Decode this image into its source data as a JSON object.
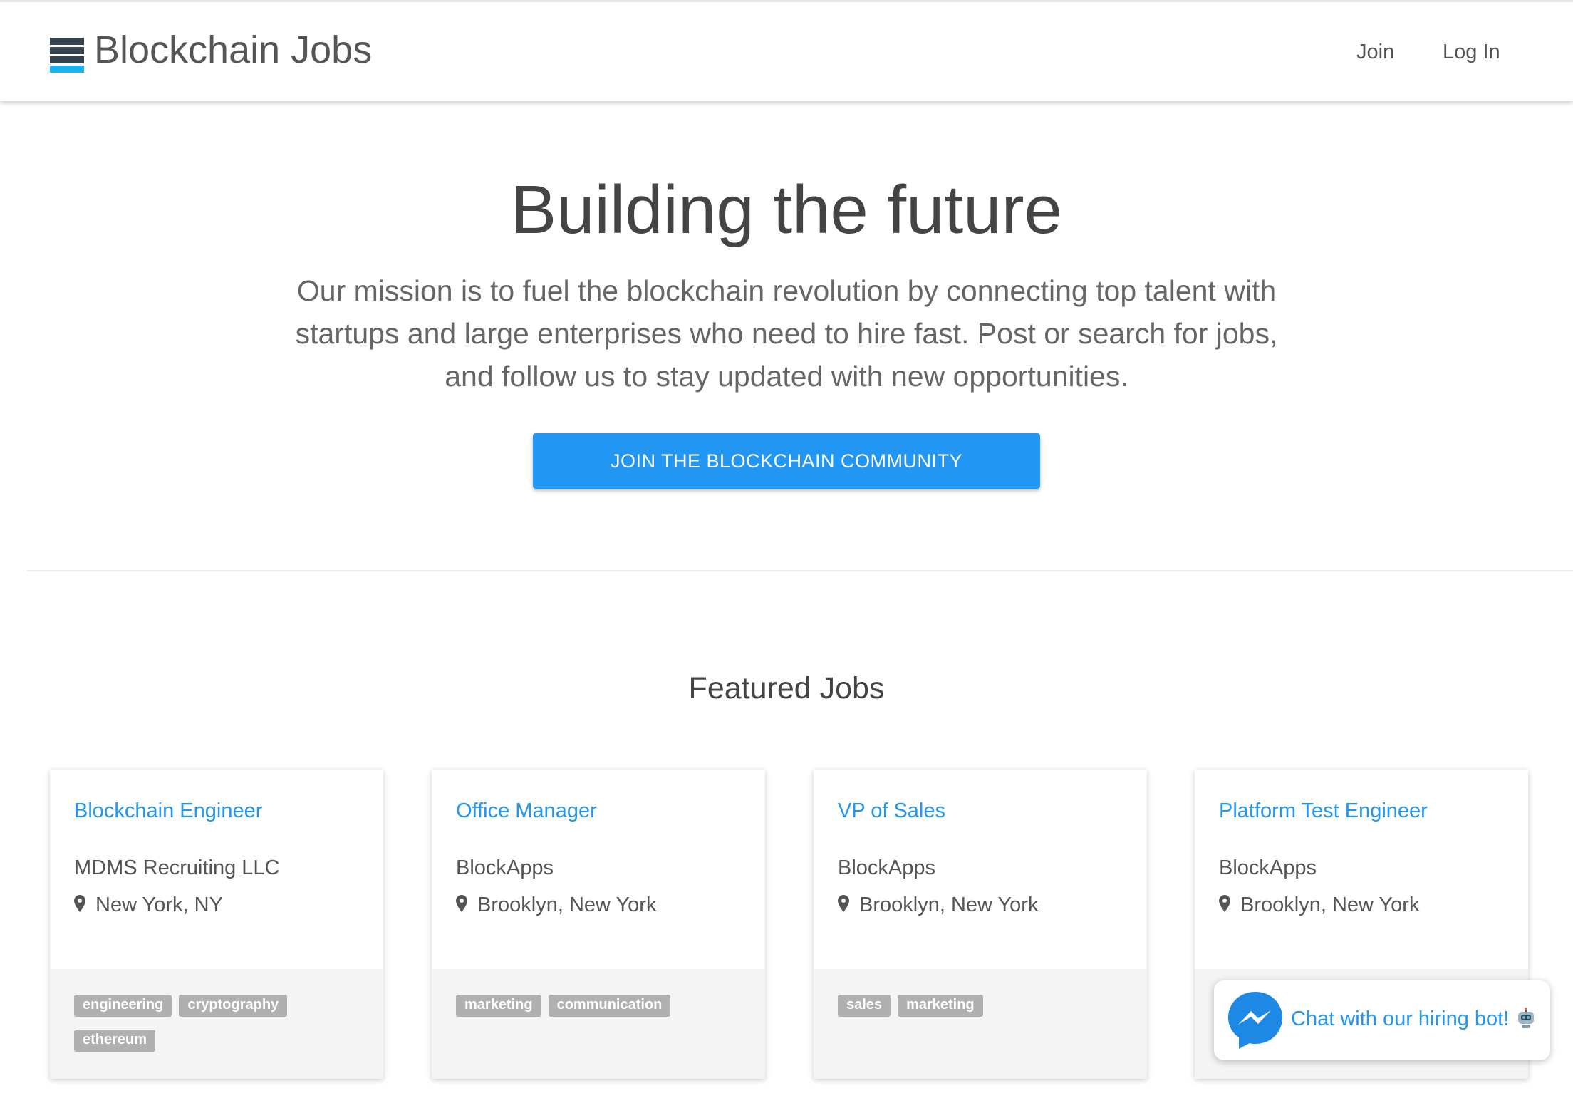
{
  "header": {
    "brand": "Blockchain Jobs",
    "nav": {
      "join": "Join",
      "login": "Log In"
    }
  },
  "hero": {
    "title": "Building the future",
    "description": "Our mission is to fuel the blockchain revolution by connecting top talent with startups and large enterprises who need to hire fast. Post or search for jobs, and follow us to stay updated with new opportunities.",
    "cta_label": "JOIN THE BLOCKCHAIN COMMUNITY"
  },
  "featured": {
    "title": "Featured Jobs",
    "jobs": [
      {
        "title": "Blockchain Engineer",
        "company": "MDMS Recruiting LLC",
        "location": "New York, NY",
        "tags": [
          "engineering",
          "cryptography",
          "ethereum"
        ]
      },
      {
        "title": "Office Manager",
        "company": "BlockApps",
        "location": "Brooklyn, New York",
        "tags": [
          "marketing",
          "communication"
        ]
      },
      {
        "title": "VP of Sales",
        "company": "BlockApps",
        "location": "Brooklyn, New York",
        "tags": [
          "sales",
          "marketing"
        ]
      },
      {
        "title": "Platform Test Engineer",
        "company": "BlockApps",
        "location": "Brooklyn, New York",
        "tags": []
      }
    ]
  },
  "chat": {
    "label": "Chat with our hiring bot!",
    "icon": "messenger-icon",
    "emoji_icon": "robot-icon"
  },
  "colors": {
    "accent": "#2196f3",
    "logo_dark": "#35434f",
    "logo_light": "#1ab2f0",
    "tag_bg": "#b0b0b0",
    "card_footer": "#f4f4f4"
  }
}
